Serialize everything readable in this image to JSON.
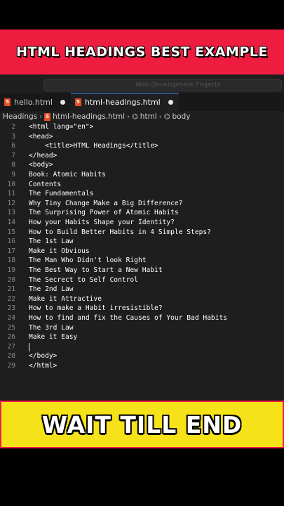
{
  "top_banner": {
    "text": "HTML HEADINGS BEST EXAMPLE"
  },
  "titlebar": {
    "search_text": "Web Development Projects"
  },
  "tabs": [
    {
      "label": "hello.html",
      "icon": "html5-icon"
    },
    {
      "label": "html-headings.html",
      "icon": "html5-icon",
      "active": true
    }
  ],
  "breadcrumb": [
    "Headings",
    "html-headings.html",
    "html",
    "body"
  ],
  "editor": {
    "lines": [
      {
        "n": "2",
        "code": "<html lang=\"en\">"
      },
      {
        "n": "3",
        "code": "<head>"
      },
      {
        "n": "6",
        "code": "    <title>HTML Headings</title>"
      },
      {
        "n": "7",
        "code": "</head>"
      },
      {
        "n": "8",
        "code": "<body>"
      },
      {
        "n": "9",
        "code": "Book: Atomic Habits"
      },
      {
        "n": "10",
        "code": "Contents"
      },
      {
        "n": "11",
        "code": "The Fundamentals"
      },
      {
        "n": "12",
        "code": "Why Tiny Change Make a Big Difference?"
      },
      {
        "n": "13",
        "code": "The Surprising Power of Atomic Habits"
      },
      {
        "n": "14",
        "code": "How your Habits Shape your Identity?"
      },
      {
        "n": "15",
        "code": "How to Build Better Habits in 4 Simple Steps?"
      },
      {
        "n": "16",
        "code": "The 1st Law"
      },
      {
        "n": "17",
        "code": "Make it Obvious"
      },
      {
        "n": "18",
        "code": "The Man Who Didn't look Right"
      },
      {
        "n": "19",
        "code": "The Best Way to Start a New Habit"
      },
      {
        "n": "20",
        "code": "The Secrect to Self Control"
      },
      {
        "n": "21",
        "code": "The 2nd Law"
      },
      {
        "n": "22",
        "code": "Make it Attractive"
      },
      {
        "n": "23",
        "code": "How to make a Habit irresistible?"
      },
      {
        "n": "24",
        "code": "How to find and fix the Causes of Your Bad Habits"
      },
      {
        "n": "25",
        "code": "The 3rd Law"
      },
      {
        "n": "26",
        "code": "Make it Easy"
      },
      {
        "n": "27",
        "code": ""
      },
      {
        "n": "28",
        "code": "</body>"
      },
      {
        "n": "29",
        "code": "</html>"
      }
    ]
  },
  "bottom_banner": {
    "text": "WAIT TILL END"
  },
  "colors": {
    "red_banner": "#ee1d3f",
    "yellow_banner": "#f6e219",
    "editor_bg": "#1e1e1e",
    "html_icon": "#e44d26"
  }
}
